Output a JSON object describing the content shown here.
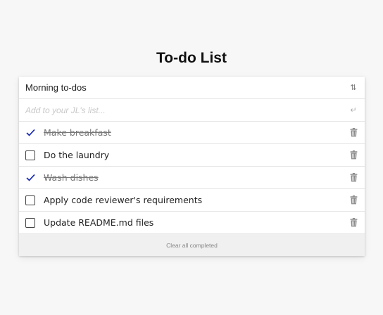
{
  "page_title": "To-do List",
  "list": {
    "name": "Morning to-dos",
    "sort_icon": "sort-arrows-icon",
    "input_placeholder": "Add to your JL's list...",
    "input_value": "",
    "enter_icon": "enter-return-icon"
  },
  "todos": [
    {
      "label": "Make breakfast",
      "done": true
    },
    {
      "label": "Do the laundry",
      "done": false
    },
    {
      "label": "Wash dishes",
      "done": true
    },
    {
      "label": "Apply code reviewer's requirements",
      "done": false
    },
    {
      "label": "Update README.md files",
      "done": false
    }
  ],
  "footer": {
    "clear_label": "Clear all completed"
  },
  "colors": {
    "check": "#1a2bb3",
    "trash": "#8a8a8a",
    "background": "#f7f7f7"
  }
}
